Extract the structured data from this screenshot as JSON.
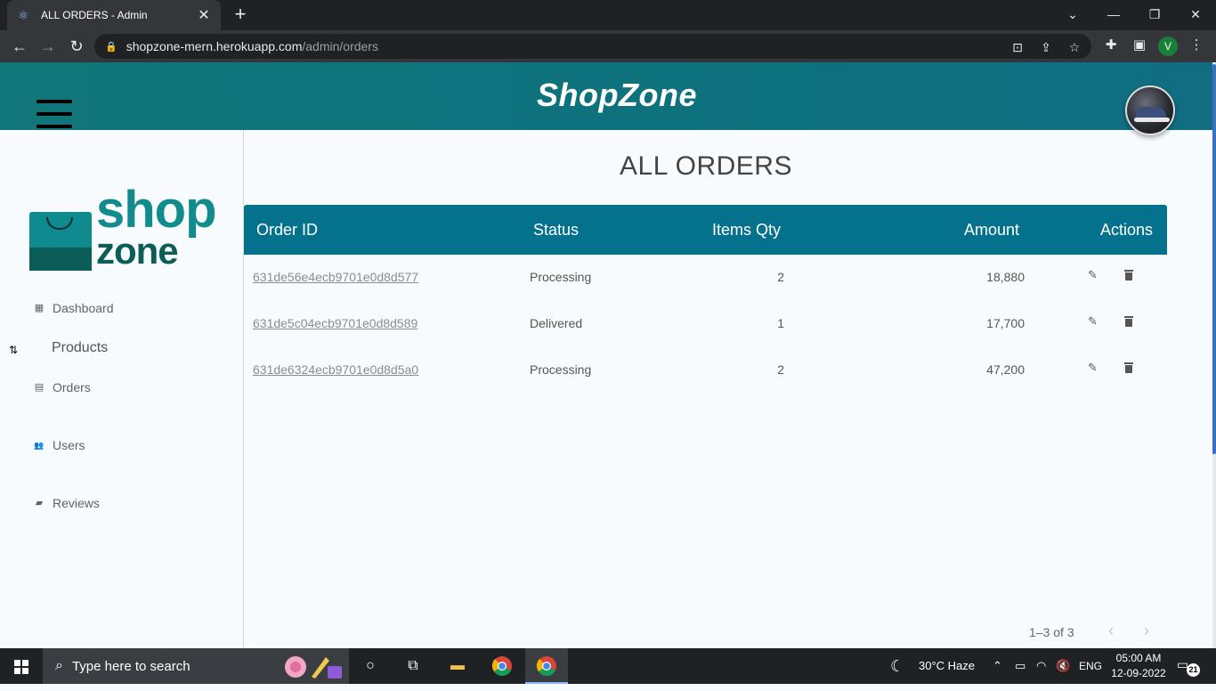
{
  "browser": {
    "tab_title": "ALL ORDERS - Admin",
    "tab_close": "✕",
    "new_tab": "+",
    "url_host": "shopzone-mern.herokuapp.com",
    "url_path": "/admin/orders",
    "profile_initial": "V",
    "window_controls": [
      "⌄",
      "—",
      "❐",
      "✕"
    ]
  },
  "header": {
    "brand": "ShopZone"
  },
  "sidebar": {
    "logo_top": "shop",
    "logo_bottom": "zone",
    "items": [
      {
        "label": "Dashboard",
        "icon": "dashboard-icon",
        "glyph": "▦"
      },
      {
        "label": "Products",
        "icon": "expand-icon",
        "glyph": "⇅"
      },
      {
        "label": "Orders",
        "icon": "list-alt-icon",
        "glyph": "▤"
      },
      {
        "label": "Users",
        "icon": "people-icon",
        "glyph": "👥"
      },
      {
        "label": "Reviews",
        "icon": "rate-review-icon",
        "glyph": "▰"
      }
    ]
  },
  "main": {
    "title": "ALL ORDERS",
    "columns": [
      "Order ID",
      "Status",
      "Items Qty",
      "Amount",
      "Actions"
    ],
    "rows": [
      {
        "id": "631de56e4ecb9701e0d8d577",
        "status": "Processing",
        "qty": "2",
        "amount": "18,880"
      },
      {
        "id": "631de5c04ecb9701e0d8d589",
        "status": "Delivered",
        "qty": "1",
        "amount": "17,700"
      },
      {
        "id": "631de6324ecb9701e0d8d5a0",
        "status": "Processing",
        "qty": "2",
        "amount": "47,200"
      }
    ],
    "pagination": "1–3 of 3"
  },
  "taskbar": {
    "search_placeholder": "Type here to search",
    "weather": "30°C  Haze",
    "lang": "ENG",
    "time": "05:00 AM",
    "date": "12-09-2022",
    "notifications": "21"
  },
  "colors": {
    "header_teal": "#0d727c",
    "grid_header": "#05728d",
    "logo_teal": "#118b8b",
    "logo_dark": "#0c5d55"
  }
}
